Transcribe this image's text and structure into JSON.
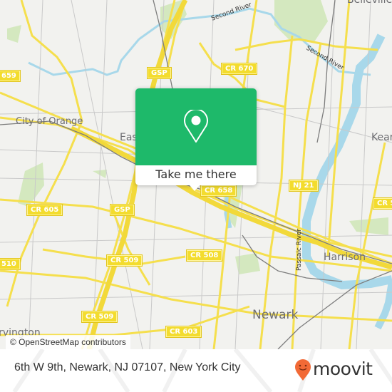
{
  "map": {
    "place_labels": [
      {
        "name": "Belleville",
        "size": "lg"
      },
      {
        "name": "City of Orange",
        "size": "lg"
      },
      {
        "name": "East Orange",
        "size": "lg"
      },
      {
        "name": "Kearny",
        "size": "lg"
      },
      {
        "name": "Harrison",
        "size": "lg"
      },
      {
        "name": "Newark",
        "size": "xl"
      },
      {
        "name": "Irvington",
        "size": "lg"
      }
    ],
    "water_labels": [
      "Second River",
      "Second River",
      "Passaic River"
    ],
    "road_shields": [
      "659",
      "GSP",
      "CR 670",
      "CR 605",
      "GSP",
      "CR 658",
      "NJ 21",
      "CR 5",
      "510",
      "CR 509",
      "CR 508",
      "CR 509",
      "CR 603"
    ],
    "attribution": "© OpenStreetMap contributors",
    "colors": {
      "land": "#f2f2ef",
      "road": "#f5df4d",
      "water": "#a8d8ea",
      "park": "#cfe6b5",
      "rail": "#7a7a7a"
    }
  },
  "popup": {
    "icon": "map-pin-icon",
    "button_label": "Take me there",
    "accent": "#1eb96a"
  },
  "footer": {
    "address": "6th W 9th, Newark, NJ 07107, New York City",
    "brand": "moovit",
    "brand_icon": "moovit-smiley-pin-icon",
    "brand_color": "#f26a36"
  }
}
